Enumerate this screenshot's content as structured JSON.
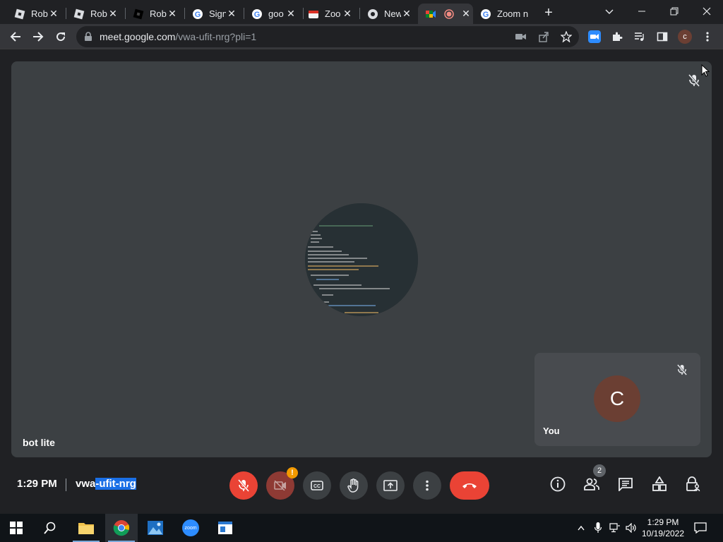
{
  "browser": {
    "tabs": [
      {
        "label": "Rob",
        "favicon": "roblox-icon"
      },
      {
        "label": "Rob",
        "favicon": "roblox-icon"
      },
      {
        "label": "Rob",
        "favicon": "roblox-black-icon"
      },
      {
        "label": "Sign",
        "favicon": "google-icon"
      },
      {
        "label": "goo",
        "favicon": "google-icon"
      },
      {
        "label": "Zoo",
        "favicon": "zoom-page-icon"
      },
      {
        "label": "New",
        "favicon": "chrome-icon"
      },
      {
        "label": "",
        "favicon": "meet-icon",
        "recording": true,
        "active": true
      },
      {
        "label": "Zoom n",
        "favicon": "google-icon"
      }
    ],
    "url_host": "meet.google.com",
    "url_path": "/vwa-ufit-nrg?pli=1",
    "profile_initial": "c"
  },
  "meet": {
    "presenter_name": "bot lite",
    "self_label": "You",
    "self_initial": "C",
    "time": "1:29 PM",
    "code_prefix": "vwa",
    "code_selected": "-ufit-nrg",
    "participant_count": "2",
    "cam_warning": "!",
    "colors": {
      "red": "#ea4335",
      "tile": "#3c4043",
      "self_tile": "#484b4f",
      "avatar": "#6b3f33"
    }
  },
  "taskbar": {
    "time": "1:29 PM",
    "date": "10/19/2022",
    "zoom_label": "zoom"
  }
}
